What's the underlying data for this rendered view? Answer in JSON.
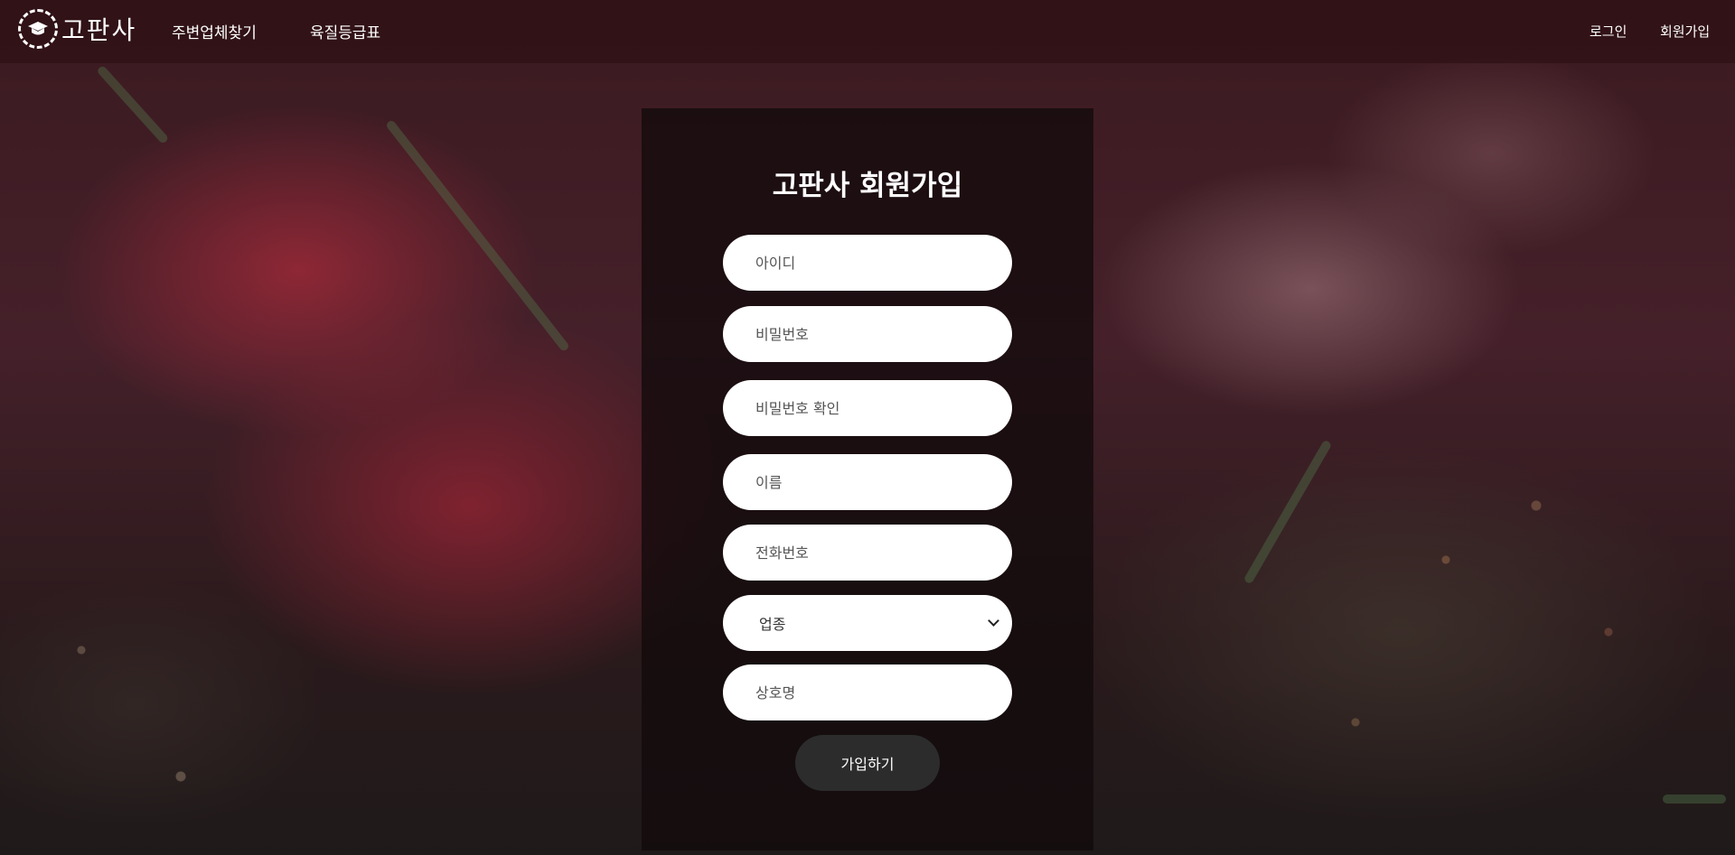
{
  "header": {
    "logo_text": "고판사",
    "nav": [
      {
        "label": "주변업체찾기"
      },
      {
        "label": "육질등급표"
      }
    ],
    "login_label": "로그인",
    "signup_label": "회원가입"
  },
  "form": {
    "title": "고판사 회원가입",
    "fields": [
      {
        "placeholder": "아이디"
      },
      {
        "placeholder": "비밀번호"
      },
      {
        "placeholder": "비밀번호 확인"
      },
      {
        "placeholder": "이름"
      },
      {
        "placeholder": "전화번호"
      }
    ],
    "business_type": {
      "selected": "업종"
    },
    "company_name": {
      "placeholder": "상호명"
    },
    "submit_label": "가입하기"
  },
  "colors": {
    "header_bg": "#280c10",
    "panel_bg": "#120a0c",
    "button_bg": "#2c2c2c",
    "text": "#ffffff"
  },
  "icons": {
    "logo": "graduation-cap-icon",
    "select": "chevron-down-icon"
  }
}
